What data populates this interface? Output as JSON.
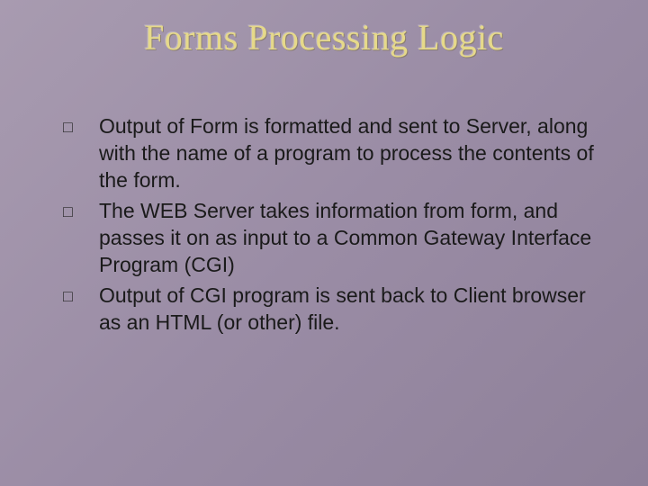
{
  "title": "Forms Processing Logic",
  "bullets": [
    {
      "marker": "□",
      "text": "Output of Form is formatted and sent to Server, along with the name of a program to process the contents of the form."
    },
    {
      "marker": "□",
      "text": "The WEB Server takes information from form, and passes it on as input to a Common Gateway Interface Program (CGI)"
    },
    {
      "marker": "□",
      "text": "Output of CGI  program is sent back to Client browser as an HTML (or other) file."
    }
  ]
}
